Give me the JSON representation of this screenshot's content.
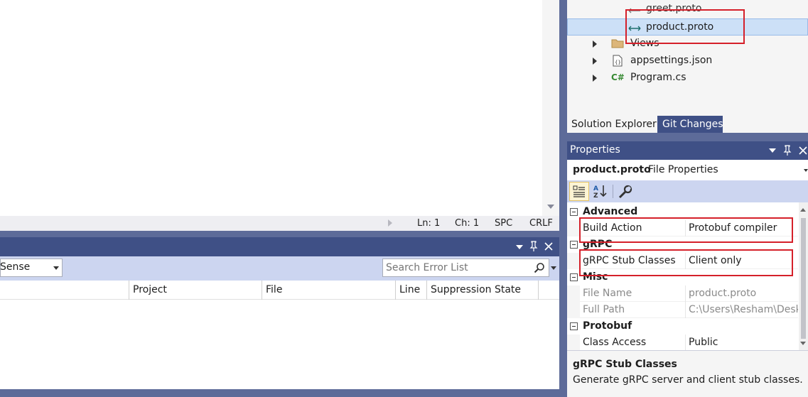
{
  "editor_status": {
    "line": "Ln: 1",
    "col": "Ch: 1",
    "whitespace": "SPC",
    "line_ending": "CRLF"
  },
  "error_list": {
    "filter_value": "Sense",
    "search_placeholder": "Search Error List",
    "columns": [
      "Project",
      "File",
      "Line",
      "Suppression State"
    ]
  },
  "solution_explorer": {
    "items": [
      {
        "label": "greet.proto",
        "icon": "proto-file-icon"
      },
      {
        "label": "product.proto",
        "icon": "proto-file-icon",
        "selected": true
      },
      {
        "label": "Views",
        "icon": "folder-icon"
      },
      {
        "label": "appsettings.json",
        "icon": "json-file-icon"
      },
      {
        "label": "Program.cs",
        "icon": "csharp-file-icon"
      }
    ],
    "tabs": [
      "Solution Explorer",
      "Git Changes"
    ]
  },
  "properties": {
    "title": "Properties",
    "object_name": "product.proto",
    "object_type": "File Properties",
    "categories": [
      {
        "name": "Advanced",
        "props": [
          {
            "name": "Build Action",
            "value": "Protobuf compiler"
          }
        ]
      },
      {
        "name": "gRPC",
        "props": [
          {
            "name": "gRPC Stub Classes",
            "value": "Client only"
          }
        ]
      },
      {
        "name": "Misc",
        "props": [
          {
            "name": "File Name",
            "value": "product.proto"
          },
          {
            "name": "Full Path",
            "value": "C:\\Users\\Resham\\Deskt"
          }
        ]
      },
      {
        "name": "Protobuf",
        "props": [
          {
            "name": "Class Access",
            "value": "Public"
          }
        ]
      }
    ],
    "description_title": "gRPC Stub Classes",
    "description_text": "Generate gRPC server and client stub classes."
  },
  "colors": {
    "title_bar": "#3f5086",
    "divider": "#5d6b99",
    "toolbar": "#ccd5f0",
    "selection": "#cce0f7",
    "highlight_box": "#d5202a"
  }
}
